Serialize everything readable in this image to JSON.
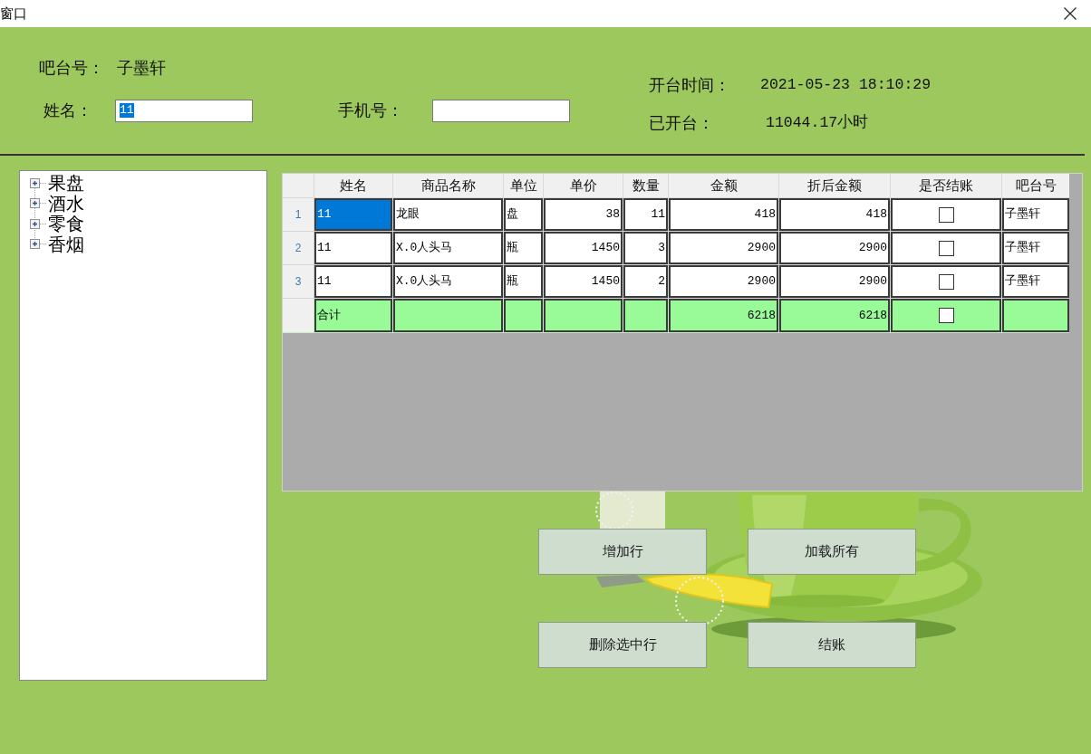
{
  "window": {
    "title": "窗口"
  },
  "bar": {
    "label": "吧台号：",
    "value": "子墨轩"
  },
  "customer": {
    "name": {
      "label": "姓名：",
      "value": "11",
      "value_selected": true
    },
    "phone": {
      "label": "手机号："
    }
  },
  "session": [
    {
      "label": "开台时间：",
      "value": "2021-05-23 18:10:29"
    },
    {
      "label": "已开台：",
      "value": "11044.17小时"
    }
  ],
  "tree": {
    "items": [
      {
        "label": "果盘",
        "expanded": false
      },
      {
        "label": "酒水",
        "expanded": false
      },
      {
        "label": "零食",
        "expanded": false
      },
      {
        "label": "香烟",
        "expanded": false
      }
    ]
  },
  "table": {
    "columns": [
      "姓名",
      "商品名称",
      "单位",
      "单价",
      "数量",
      "金额",
      "折后金额",
      "是否结账",
      "吧台号"
    ],
    "rows": [
      {
        "kind": "data",
        "number": "1",
        "cells": [
          {
            "kind": "text",
            "text": "11",
            "selected": true
          },
          {
            "kind": "text",
            "text": "龙眼",
            "selected": false
          },
          {
            "kind": "text",
            "text": "盘",
            "selected": false
          },
          {
            "kind": "number",
            "text": "38",
            "selected": false
          },
          {
            "kind": "number",
            "text": "11",
            "selected": false
          },
          {
            "kind": "number",
            "text": "418",
            "selected": false
          },
          {
            "kind": "number",
            "text": "418",
            "selected": false
          },
          {
            "kind": "checkbox",
            "checked": false,
            "selected": false
          },
          {
            "kind": "text",
            "text": "子墨轩",
            "selected": false
          }
        ]
      },
      {
        "kind": "data",
        "number": "2",
        "cells": [
          {
            "kind": "text",
            "text": "11",
            "selected": false
          },
          {
            "kind": "text",
            "text": "X.0人头马",
            "selected": false
          },
          {
            "kind": "text",
            "text": "瓶",
            "selected": false
          },
          {
            "kind": "number",
            "text": "1450",
            "selected": false
          },
          {
            "kind": "number",
            "text": "3",
            "selected": false
          },
          {
            "kind": "number",
            "text": "2900",
            "selected": false
          },
          {
            "kind": "number",
            "text": "2900",
            "selected": false
          },
          {
            "kind": "checkbox",
            "checked": false,
            "selected": false
          },
          {
            "kind": "text",
            "text": "子墨轩",
            "selected": false
          }
        ]
      },
      {
        "kind": "data",
        "number": "3",
        "cells": [
          {
            "kind": "text",
            "text": "11",
            "selected": false
          },
          {
            "kind": "text",
            "text": "X.0人头马",
            "selected": false
          },
          {
            "kind": "text",
            "text": "瓶",
            "selected": false
          },
          {
            "kind": "number",
            "text": "1450",
            "selected": false
          },
          {
            "kind": "number",
            "text": "2",
            "selected": false
          },
          {
            "kind": "number",
            "text": "2900",
            "selected": false
          },
          {
            "kind": "number",
            "text": "2900",
            "selected": false
          },
          {
            "kind": "checkbox",
            "checked": false,
            "selected": false
          },
          {
            "kind": "text",
            "text": "子墨轩",
            "selected": false
          }
        ]
      },
      {
        "kind": "total",
        "cells": [
          {
            "kind": "text",
            "text": "合计",
            "selected": false
          },
          {
            "kind": "blank",
            "selected": false
          },
          {
            "kind": "blank",
            "selected": false
          },
          {
            "kind": "blank",
            "selected": false
          },
          {
            "kind": "blank",
            "selected": false
          },
          {
            "kind": "number",
            "text": "6218",
            "selected": false
          },
          {
            "kind": "number",
            "text": "6218",
            "selected": false
          },
          {
            "kind": "checkbox",
            "checked": false,
            "selected": false
          },
          {
            "kind": "blank",
            "selected": false
          }
        ]
      }
    ]
  },
  "buttons": [
    "增加行",
    "加载所有",
    "删除选中行",
    "结账"
  ]
}
